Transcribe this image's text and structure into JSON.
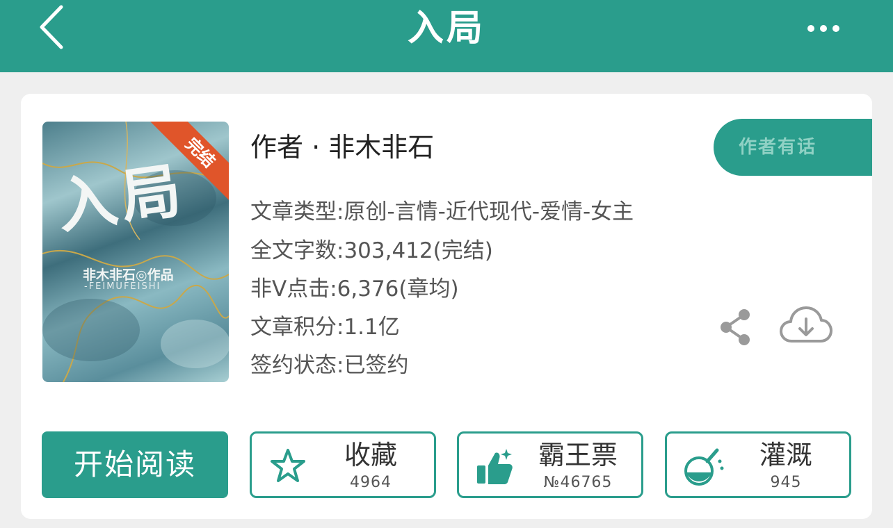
{
  "header": {
    "title": "入局"
  },
  "book": {
    "cover": {
      "title": "入局",
      "author": "非木非石◎作品",
      "author_en": "-FEIMUFEISHI",
      "badge": "完结"
    },
    "author_line": "作者 · 非木非石",
    "info_lines": [
      "文章类型:原创-言情-近代现代-爱情-女主",
      "全文字数:303,412(完结)",
      "非V点击:6,376(章均)",
      "文章积分:1.1亿",
      "签约状态:已签约"
    ],
    "pill_label": "作者有话"
  },
  "actions": {
    "read_label": "开始阅读",
    "collect": {
      "label": "收藏",
      "count": "4964",
      "icon": "star-icon"
    },
    "ticket": {
      "label": "霸王票",
      "count": "№46765",
      "icon": "thumbs-up-icon"
    },
    "water": {
      "label": "灌溉",
      "count": "945",
      "icon": "flask-icon"
    }
  },
  "colors": {
    "accent": "#2a9d8c",
    "badge": "#e0552a"
  }
}
